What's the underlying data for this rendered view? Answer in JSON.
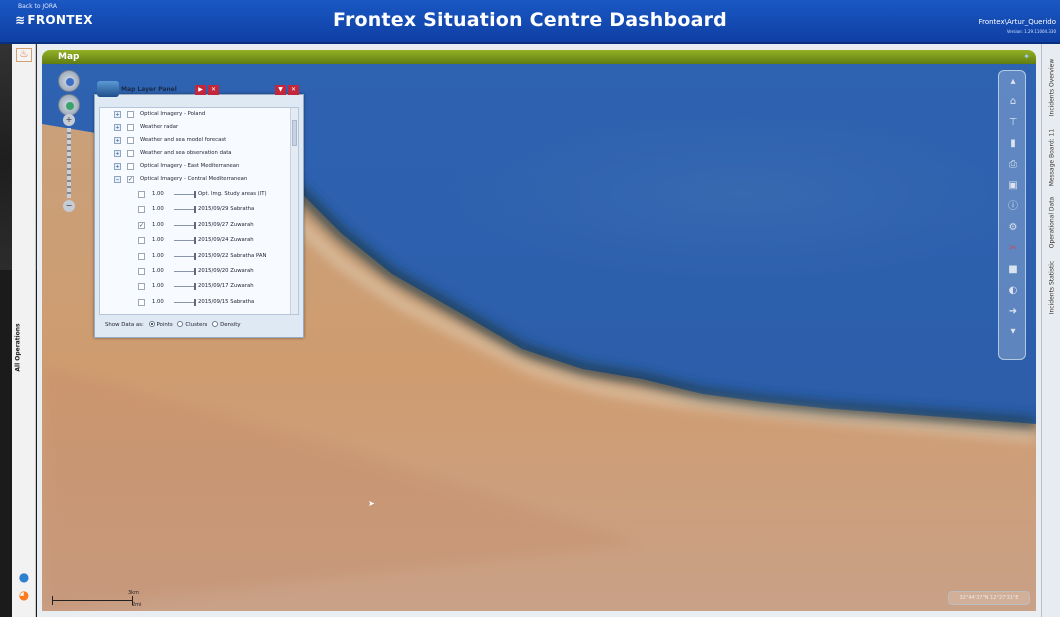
{
  "header": {
    "back_link": "Back to JORA",
    "brand": "FRONTEX",
    "title": "Frontex Situation Centre Dashboard",
    "user": "Frontex\\Artur_Querido",
    "version": "Version: 1.29.11004.330"
  },
  "left_rail": {
    "all_operations": "All Operations"
  },
  "map": {
    "title": "Map",
    "scale_km": "3km",
    "scale_mi": "2mi",
    "coordinates": "32°44'37\"N 12°27'31\"E"
  },
  "layer_panel": {
    "title": "Map Layer Panel",
    "top_layers": [
      {
        "label": "Optical Imagery - Poland",
        "checked": false
      },
      {
        "label": "Weather radar",
        "checked": false
      },
      {
        "label": "Weather and sea model forecast",
        "checked": false
      },
      {
        "label": "Weather and sea observation data",
        "checked": false
      },
      {
        "label": "Optical Imagery - East Mediterranean",
        "checked": false
      },
      {
        "label": "Optical Imagery - Central Mediterranean",
        "checked": true
      }
    ],
    "sub_layers": [
      {
        "opacity": "1.00",
        "label": "Opt. Img. Study areas (IT)",
        "checked": false
      },
      {
        "opacity": "1.00",
        "label": "2015/09/29 Sabratha",
        "checked": false
      },
      {
        "opacity": "1.00",
        "label": "2015/09/27 Zuwarah",
        "checked": true
      },
      {
        "opacity": "1.00",
        "label": "2015/09/24 Zuwarah",
        "checked": false
      },
      {
        "opacity": "1.00",
        "label": "2015/09/22 Sabratha PAN",
        "checked": false
      },
      {
        "opacity": "1.00",
        "label": "2015/09/20 Zuwarah",
        "checked": false
      },
      {
        "opacity": "1.00",
        "label": "2015/09/17 Zuwarah",
        "checked": false
      },
      {
        "opacity": "1.00",
        "label": "2015/09/15 Sabratha",
        "checked": false
      }
    ],
    "show_data_label": "Show Data as:",
    "show_options": [
      "Points",
      "Clusters",
      "Density"
    ],
    "show_selected": "Points"
  },
  "right_tabs": [
    "Incidents Overview",
    "Message Board: 11",
    "Operational Data",
    "Incidents Statistic"
  ],
  "colors": {
    "header_blue": "#1248b5",
    "map_bar_green": "#7a9a1a",
    "sea": "#2b5ca8",
    "land": "#c99a72",
    "panel_close": "#c4273b"
  }
}
